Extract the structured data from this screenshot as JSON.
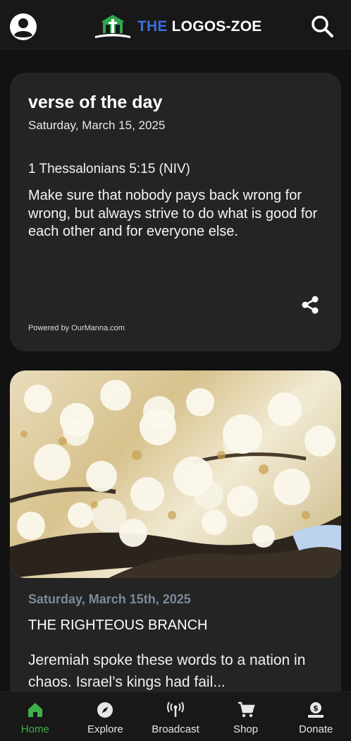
{
  "header": {
    "brand_prefix": "THE",
    "brand_name": "LOGOS-ZOE",
    "icons": [
      "account-icon",
      "logo-icon",
      "search-icon"
    ]
  },
  "verse_card": {
    "title": "verse of the day",
    "date": "Saturday, March 15, 2025",
    "reference": "1 Thessalonians 5:15 (NIV)",
    "text": "Make sure that nobody pays back wrong for wrong, but always strive to do what is good for each other and for everyone else.",
    "powered_by": "Powered by OurManna.com",
    "share_icon": "share-icon"
  },
  "devotional": {
    "date": "Saturday, March 15th, 2025",
    "title": "THE RIGHTEOUS BRANCH",
    "excerpt": "Jeremiah spoke these words to a nation in chaos. Israel’s kings had fail..."
  },
  "bottom_nav": {
    "items": [
      {
        "label": "Home",
        "icon": "home-icon",
        "active": true
      },
      {
        "label": "Explore",
        "icon": "compass-icon",
        "active": false
      },
      {
        "label": "Broadcast",
        "icon": "broadcast-icon",
        "active": false
      },
      {
        "label": "Shop",
        "icon": "cart-icon",
        "active": false
      },
      {
        "label": "Donate",
        "icon": "donate-icon",
        "active": false
      }
    ],
    "active_color": "#3fae49"
  },
  "colors": {
    "background": "#121212",
    "card": "#242424",
    "brand_blue": "#3b6fd8",
    "accent_green": "#3fae49",
    "date_gray": "#7c8a9b"
  }
}
